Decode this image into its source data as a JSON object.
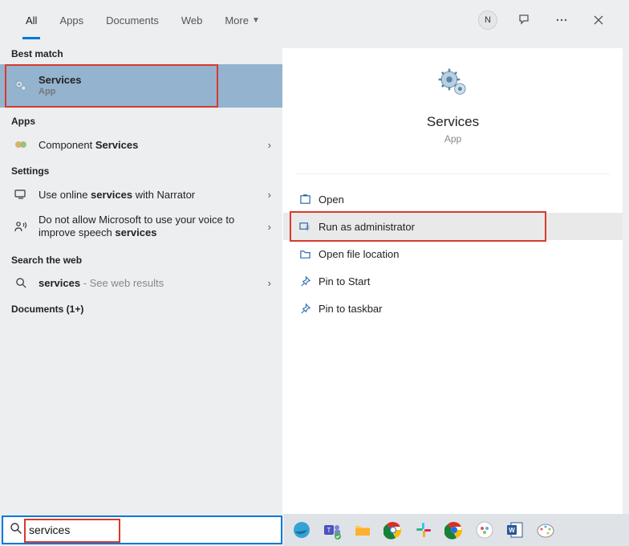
{
  "tabs": {
    "all": "All",
    "apps": "Apps",
    "documents": "Documents",
    "web": "Web",
    "more": "More"
  },
  "avatar_initial": "N",
  "left": {
    "best_match_hdr": "Best match",
    "best_match": {
      "title": "Services",
      "subtitle": "App"
    },
    "apps_hdr": "Apps",
    "app1_prefix": "Component ",
    "app1_bold": "Services",
    "settings_hdr": "Settings",
    "set1_prefix": "Use online ",
    "set1_bold": "services",
    "set1_suffix": " with Narrator",
    "set2_prefix": "Do not allow Microsoft to use your voice to improve speech ",
    "set2_bold": "services",
    "web_hdr": "Search the web",
    "web1_bold": "services",
    "web1_suffix": " - See web results",
    "docs_hdr": "Documents (1+)"
  },
  "right": {
    "title": "Services",
    "subtitle": "App",
    "actions": {
      "open": "Open",
      "run_admin": "Run as administrator",
      "open_loc": "Open file location",
      "pin_start": "Pin to Start",
      "pin_task": "Pin to taskbar"
    }
  },
  "search": {
    "value": "services"
  }
}
